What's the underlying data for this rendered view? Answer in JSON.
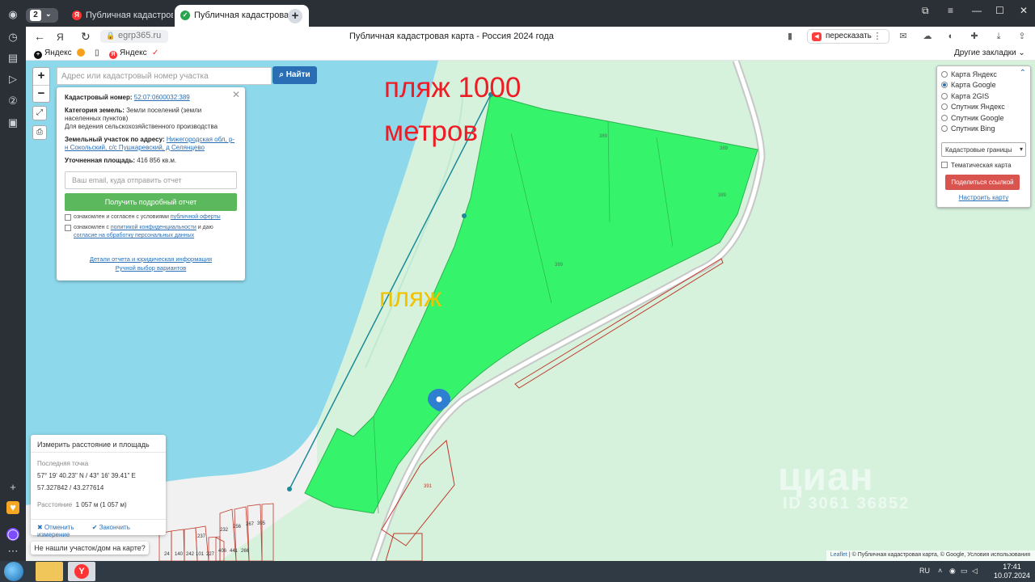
{
  "browser": {
    "tab_count": "2",
    "tabs": [
      {
        "label": "Публичная кадастровая к",
        "favicon": "yandex-icon",
        "color": "#f33"
      },
      {
        "label": "Публичная кадастровая",
        "favicon": "check-icon",
        "color": "#2aa44f"
      }
    ],
    "url": "egrp365.ru",
    "page_title": "Публичная кадастровая карта - Россия 2024 года",
    "retell_label": "пересказать",
    "bookmarks": [
      "Яндекс",
      "Яндекс"
    ],
    "other_bookmarks": "Другие закладки"
  },
  "map": {
    "zoom_in": "+",
    "zoom_out": "−",
    "search_placeholder": "Адрес или кадастровый номер участка",
    "search_button": "Найти",
    "overlay_text_1": "пляж 1000",
    "overlay_text_2": "метров",
    "overlay_beach": "пляж",
    "parcel_labels": [
      "389",
      "389",
      "389",
      "389",
      "391",
      "24",
      "140",
      "242",
      "101",
      "227",
      "237",
      "232",
      "256",
      "267",
      "395",
      "406",
      "441",
      "266"
    ],
    "watermark": "циан",
    "watermark_id": "ID 3061 36852"
  },
  "info": {
    "cad_label": "Кадастровый номер:",
    "cad_value": "52:07:0600032:389",
    "category_label": "Категория земель:",
    "category_value": "Земли поселений (земли населенных пунктов)",
    "usage": "Для ведения сельскохозяйственного производства",
    "address_label": "Земельный участок по адресу:",
    "address_value": "Нижегородская обл, р-н Сокольский, с/с Пушкаревский, д Селянцево",
    "area_label": "Уточненная площадь:",
    "area_value": "416 856 кв.м.",
    "email_placeholder": "Ваш email, куда отправить отчет",
    "report_button": "Получить подробный отчет",
    "consent1_a": "ознакомлен и согласен с условиями",
    "consent1_link": "публичной оферты",
    "consent2_a": "ознакомлен с",
    "consent2_link1": "политикой конфиденциальности",
    "consent2_b": "и даю",
    "consent2_link2": "согласие на обработку персональных данных",
    "details_link": "Детали отчета и юридическая информация",
    "manual_link": "Ручной выбор вариантов"
  },
  "layers": {
    "options": [
      "Карта Яндекс",
      "Карта Google",
      "Карта 2GIS",
      "Спутник Яндекс",
      "Спутник Google",
      "Спутник Bing"
    ],
    "selected": "Карта Google",
    "boundaries": "Кадастровые границы",
    "thematic": "Тематическая карта",
    "share": "Поделиться ссылкой",
    "tune": "Настроить карту"
  },
  "measure": {
    "title": "Измерить расстояние и площадь",
    "last_point_label": "Последняя точка",
    "coords_dms": "57° 19' 40.23\" N / 43° 16' 39.41\" E",
    "coords_dec": "57.327842 / 43.277614",
    "distance_label": "Расстояние",
    "distance_value": "1 057 м (1 057 м)",
    "cancel": "Отменить",
    "finish": "Закончить измерение"
  },
  "not_found": "Не нашли участок/дом на карте?",
  "attribution": {
    "leaflet": "Leaflet",
    "rest": "| © Публичная кадастровая карта, © Google, Условия использования"
  },
  "taskbar": {
    "lang": "RU",
    "time": "17:41",
    "date": "10.07.2024"
  },
  "colors": {
    "water": "#8ed8ec",
    "land": "#d6f2dd",
    "parcel": "#35f46b",
    "parcel_border": "#2bb34c",
    "boundary_red": "#c0392b",
    "measure_line": "#1c8a99"
  }
}
